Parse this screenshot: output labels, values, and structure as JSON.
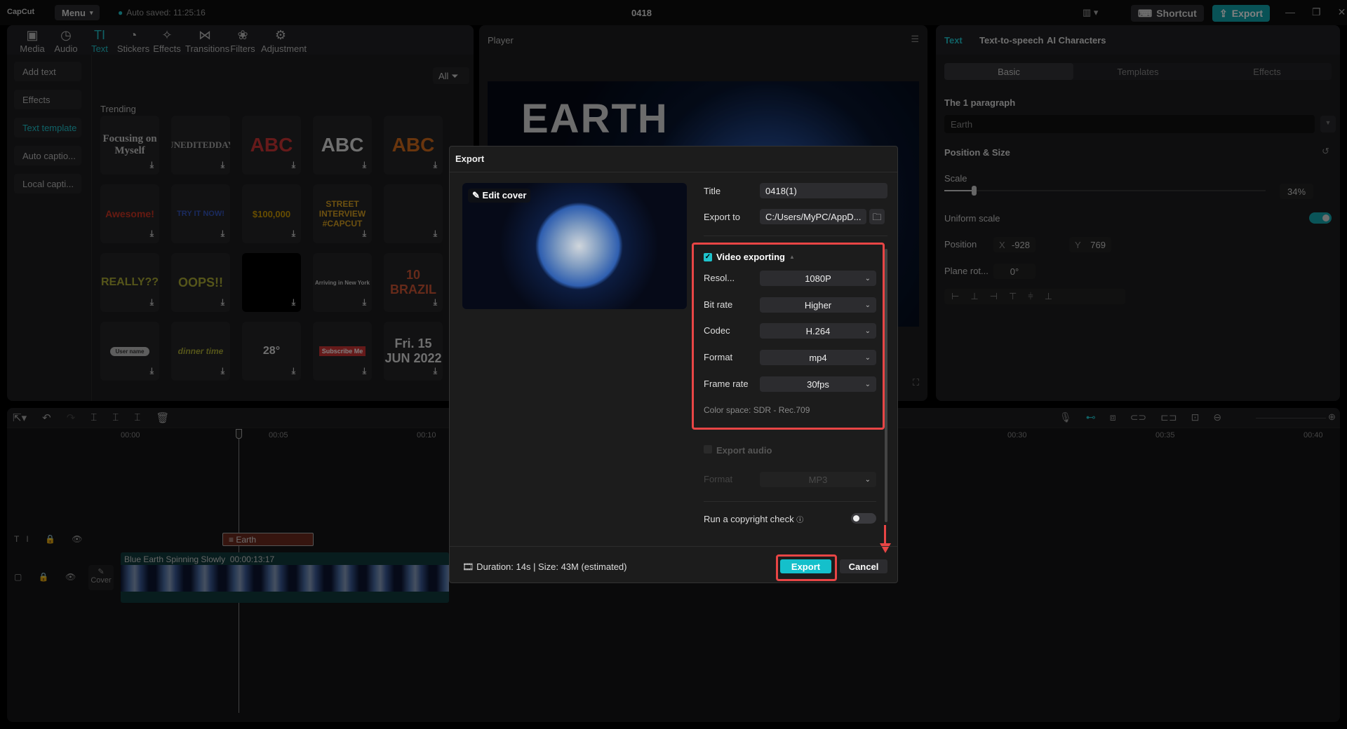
{
  "app": {
    "logo": "CapCut",
    "menu": "Menu",
    "autosave": "Auto saved: 11:25:16",
    "project_title": "0418",
    "shortcut": "Shortcut",
    "export": "Export"
  },
  "media_tabs": [
    {
      "label": "Media",
      "icon": "media-icon"
    },
    {
      "label": "Audio",
      "icon": "audio-icon"
    },
    {
      "label": "Text",
      "icon": "text-icon",
      "active": true
    },
    {
      "label": "Stickers",
      "icon": "stickers-icon"
    },
    {
      "label": "Effects",
      "icon": "effects-icon"
    },
    {
      "label": "Transitions",
      "icon": "transitions-icon"
    },
    {
      "label": "Filters",
      "icon": "filters-icon"
    },
    {
      "label": "Adjustment",
      "icon": "adjustment-icon"
    }
  ],
  "text_sidebar": [
    "Add text",
    "Effects",
    "Text template",
    "Auto captio...",
    "Local capti..."
  ],
  "filter": "All",
  "section": "Trending",
  "templates": [
    "Focusing on Myself",
    "UNEDITEDDAY",
    "ABC",
    "ABC",
    "ABC",
    "Awesome!",
    "TRY IT NOW!",
    "$100,000",
    "STREET INTERVIEW #CAPCUT",
    "",
    "REALLY??",
    "OOPS!!",
    "",
    "Arriving in New York",
    "10 BRAZIL",
    "User name",
    "dinner time",
    "28°",
    "Subscribe Me",
    "Fri. 15 JUN 2022"
  ],
  "player": {
    "label": "Player",
    "overlay_text": "EARTH"
  },
  "inspector": {
    "tabs": [
      "Text",
      "Text-to-speech",
      "AI Characters"
    ],
    "subtabs": [
      "Basic",
      "Templates",
      "Effects"
    ],
    "paragraph_label": "The 1 paragraph",
    "paragraph_value": "Earth",
    "position_size": "Position & Size",
    "scale_label": "Scale",
    "scale_value": "34%",
    "scale_level": 34,
    "uniform_scale": "Uniform scale",
    "uniform_on": true,
    "position_label": "Position",
    "x_label": "X",
    "x": "-928",
    "y_label": "Y",
    "y": "769",
    "rotation_label": "Plane rot...",
    "rotation": "0°"
  },
  "timeline": {
    "ticks": [
      "00:00",
      "00:05",
      "00:10",
      "00:30",
      "00:35",
      "00:40"
    ],
    "text_clip": "Earth",
    "video_clip": "Blue Earth Spinning Slowly",
    "video_duration": "00:00:13:17",
    "cover": "Cover"
  },
  "export_dialog": {
    "title": "Export",
    "edit_cover": "Edit cover",
    "title_label": "Title",
    "title_value": "0418(1)",
    "export_to_label": "Export to",
    "export_to_value": "C:/Users/MyPC/AppD...",
    "video_exporting": "Video exporting",
    "video_checked": true,
    "settings": [
      {
        "label": "Resol...",
        "value": "1080P"
      },
      {
        "label": "Bit rate",
        "value": "Higher"
      },
      {
        "label": "Codec",
        "value": "H.264"
      },
      {
        "label": "Format",
        "value": "mp4"
      },
      {
        "label": "Frame rate",
        "value": "30fps"
      }
    ],
    "color_space": "Color space: SDR - Rec.709",
    "export_audio": "Export audio",
    "audio_checked": false,
    "audio_format_label": "Format",
    "audio_format_value": "MP3",
    "copyright": "Run a copyright check",
    "copyright_on": false,
    "info": "Duration: 14s | Size: 43M (estimated)",
    "export_button": "Export",
    "cancel_button": "Cancel"
  },
  "colors": {
    "accent": "#1fc3cc",
    "highlight": "#e84545",
    "text_clip": "#6b2a1e",
    "video_track": "#0f3a3c"
  }
}
